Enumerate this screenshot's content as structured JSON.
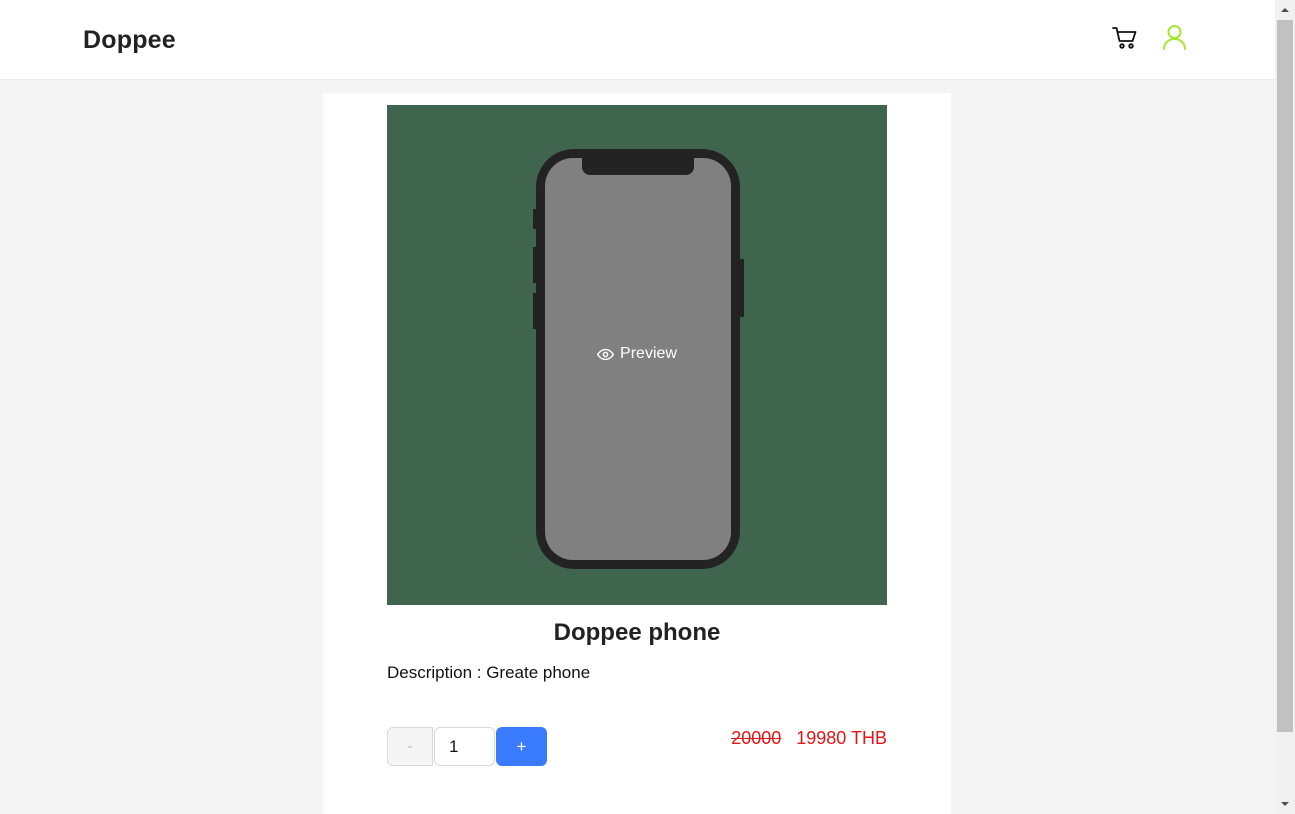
{
  "header": {
    "brand": "Doppee",
    "icons": {
      "cart": "cart-icon",
      "user": "user-icon"
    },
    "colors": {
      "user_icon": "#a6e62f",
      "cart_icon": "#111111"
    }
  },
  "product": {
    "image": {
      "background": "#3f654f",
      "icon": "eye-icon",
      "overlay_label": "Preview"
    },
    "title": "Doppee phone",
    "description": "Description : Greate phone",
    "quantity": {
      "minus_label": "-",
      "value": "1",
      "plus_label": "+"
    },
    "price": {
      "original": "20000",
      "current": "19980 THB",
      "color": "#e01616"
    }
  },
  "accent": "#3a7bfd"
}
